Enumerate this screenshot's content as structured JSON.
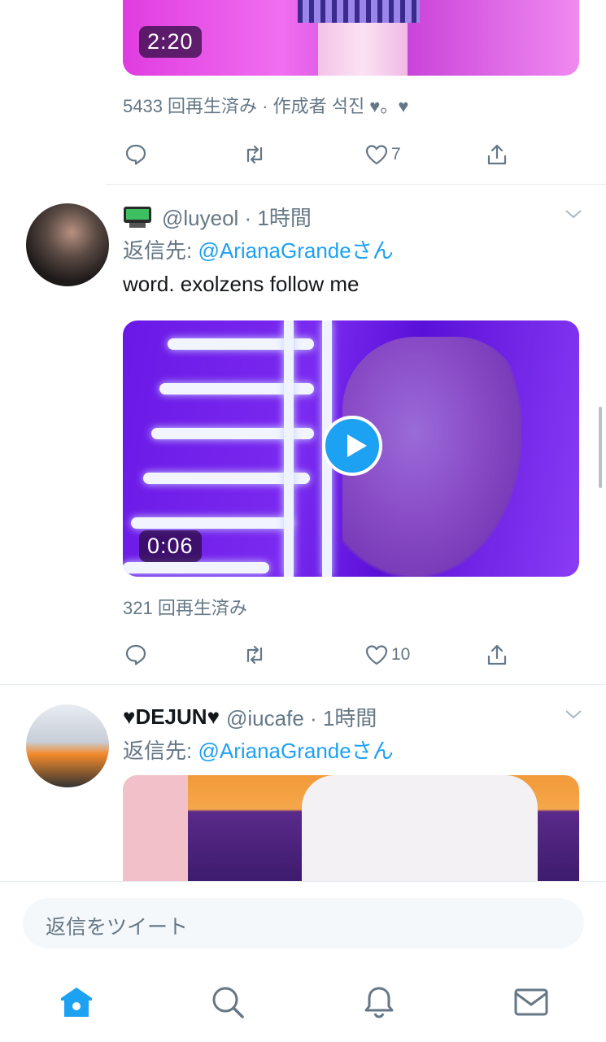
{
  "tweet1": {
    "duration": "2:20",
    "meta": "5433 回再生済み · 作成者 석진 ♥。♥",
    "likes": "7"
  },
  "tweet2": {
    "handle": "@luyeol · 1時間",
    "reply_prefix": "返信先: ",
    "reply_target": "@ArianaGrandeさん",
    "text": "word. exolzens follow me",
    "duration": "0:06",
    "meta": "321 回再生済み",
    "likes": "10"
  },
  "tweet3": {
    "display_name": "♥DEJUN♥",
    "handle": "@iucafe · 1時間",
    "reply_prefix": "返信先: ",
    "reply_target": "@ArianaGrandeさん"
  },
  "reply_bar": {
    "placeholder": "返信をツイート"
  },
  "colors": {
    "accent": "#1da1f2",
    "muted": "#657786"
  },
  "icons": [
    "reply-icon",
    "retweet-icon",
    "like-icon",
    "share-icon",
    "home-icon",
    "search-icon",
    "bell-icon",
    "mail-icon",
    "play-icon",
    "chevron-down-icon"
  ]
}
